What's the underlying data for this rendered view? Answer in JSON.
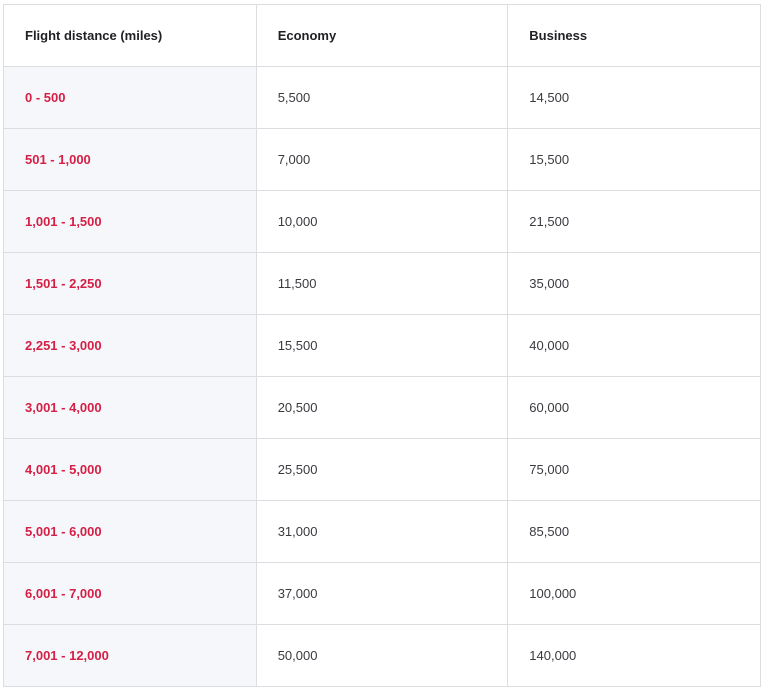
{
  "table": {
    "headers": [
      "Flight distance (miles)",
      "Economy",
      "Business"
    ],
    "rows": [
      {
        "distance": "0 - 500",
        "economy": "5,500",
        "business": "14,500"
      },
      {
        "distance": "501 - 1,000",
        "economy": "7,000",
        "business": "15,500"
      },
      {
        "distance": "1,001 - 1,500",
        "economy": "10,000",
        "business": "21,500"
      },
      {
        "distance": "1,501 - 2,250",
        "economy": "11,500",
        "business": "35,000"
      },
      {
        "distance": "2,251 - 3,000",
        "economy": "15,500",
        "business": "40,000"
      },
      {
        "distance": "3,001 - 4,000",
        "economy": "20,500",
        "business": "60,000"
      },
      {
        "distance": "4,001 - 5,000",
        "economy": "25,500",
        "business": "75,000"
      },
      {
        "distance": "5,001 - 6,000",
        "economy": "31,000",
        "business": "85,500"
      },
      {
        "distance": "6,001 - 7,000",
        "economy": "37,000",
        "business": "100,000"
      },
      {
        "distance": "7,001 - 12,000",
        "economy": "50,000",
        "business": "140,000"
      }
    ]
  },
  "colors": {
    "distance_text": "#d51f45",
    "distance_bg": "#f6f7fb",
    "border": "#dcdde1"
  }
}
